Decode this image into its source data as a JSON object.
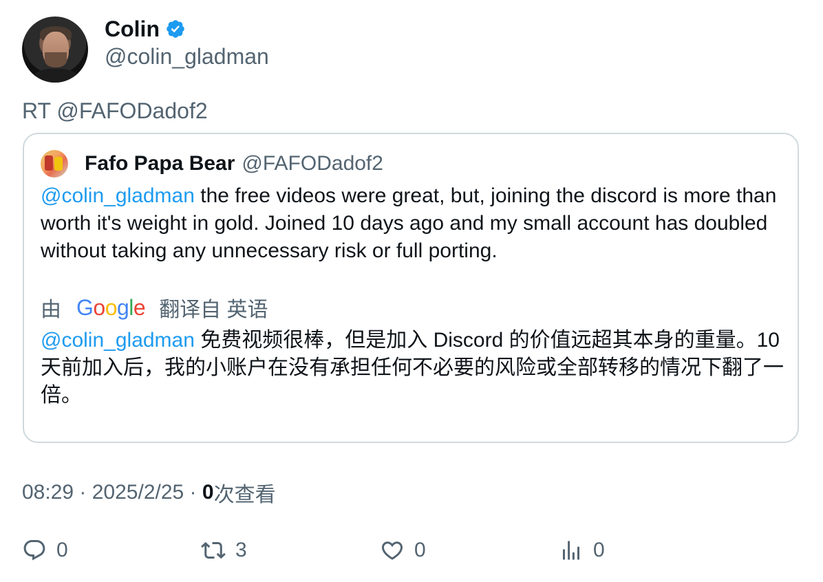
{
  "author": {
    "display_name": "Colin",
    "handle": "@colin_gladman",
    "verified": true,
    "verified_color": "#1d9bf0"
  },
  "retweet_text": "RT @FAFODadof2",
  "quoted": {
    "display_name": "Fafo Papa Bear",
    "handle": "@FAFODadof2",
    "mention": "@colin_gladman",
    "text": " the free videos were great, but, joining the discord is more than worth it's weight in gold.  Joined 10 days ago and my small account has doubled without taking any unnecessary risk or full porting.",
    "translate_prefix": "由",
    "translate_brand": "Google",
    "translate_suffix": "翻译自 英语",
    "translated_mention": "@colin_gladman",
    "translated_text": " 免费视频很棒，但是加入 Discord 的价值远超其本身的重量。10 天前加入后，我的小账户在没有承担任何不必要的风险或全部转移的情况下翻了一倍。"
  },
  "meta": {
    "time": "08:29",
    "separator": " · ",
    "date": "2025/2/25",
    "views_count": "0",
    "views_label": "次查看"
  },
  "actions": {
    "reply_count": "0",
    "retweet_count": "3",
    "like_count": "0",
    "views_count": "0",
    "icons": [
      "reply-icon",
      "retweet-icon",
      "like-icon",
      "analytics-icon"
    ]
  },
  "colors": {
    "link": "#1d9bf0",
    "secondary_text": "#536471",
    "primary_text": "#0f1419",
    "border": "#cfd9de"
  }
}
